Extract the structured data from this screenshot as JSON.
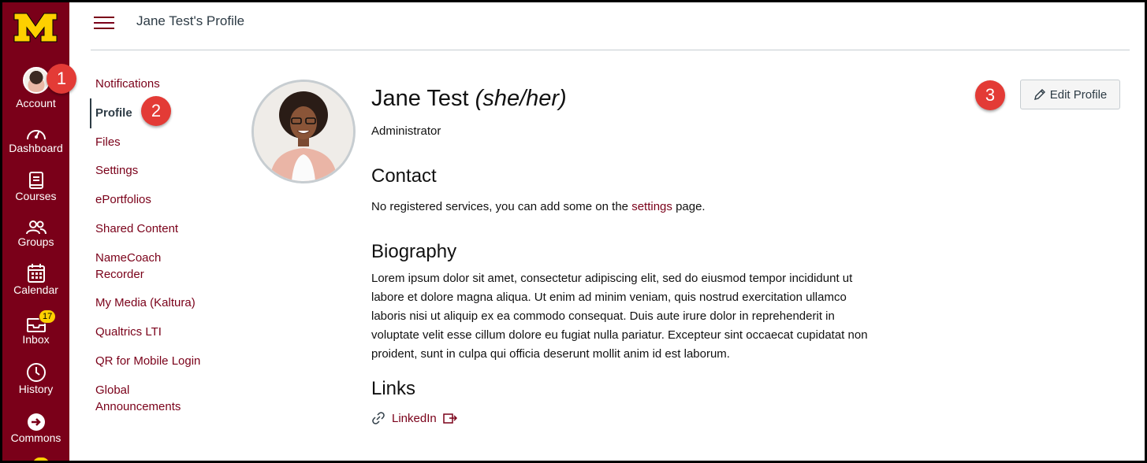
{
  "header": {
    "title": "Jane Test's Profile"
  },
  "global_nav": {
    "items": [
      {
        "label": "Account"
      },
      {
        "label": "Dashboard"
      },
      {
        "label": "Courses"
      },
      {
        "label": "Groups"
      },
      {
        "label": "Calendar"
      },
      {
        "label": "Inbox",
        "badge": "17"
      },
      {
        "label": "History"
      },
      {
        "label": "Commons"
      }
    ],
    "colors": {
      "background": "#7a0019",
      "badge": "#fdd000",
      "logo": "#fdd000"
    }
  },
  "section_nav": {
    "items": [
      {
        "label": "Notifications"
      },
      {
        "label": "Profile",
        "active": true
      },
      {
        "label": "Files"
      },
      {
        "label": "Settings"
      },
      {
        "label": "ePortfolios"
      },
      {
        "label": "Shared Content"
      },
      {
        "label": "NameCoach",
        "label2": "Recorder"
      },
      {
        "label": "My Media (Kaltura)"
      },
      {
        "label": "Qualtrics LTI"
      },
      {
        "label": "QR for Mobile Login"
      },
      {
        "label": "Global",
        "label2": "Announcements"
      }
    ]
  },
  "profile": {
    "name": "Jane Test",
    "pronouns": "(she/her)",
    "role": "Administrator",
    "edit_button": "Edit Profile",
    "contact": {
      "heading": "Contact",
      "text_before": "No registered services, you can add some on the",
      "link": "settings",
      "text_after": "page."
    },
    "biography": {
      "heading": "Biography",
      "lines": [
        "Lorem ipsum dolor sit amet, consectetur adipiscing elit, sed do eiusmod tempor incididunt ut",
        "labore et dolore magna aliqua. Ut enim ad minim veniam, quis nostrud exercitation ullamco",
        "laboris nisi ut aliquip ex ea commodo consequat. Duis aute irure dolor in reprehenderit in",
        "voluptate velit esse cillum dolore eu fugiat nulla pariatur. Excepteur sint occaecat cupidatat non",
        "proident, sunt in culpa qui officia deserunt mollit anim id est laborum."
      ]
    },
    "links": {
      "heading": "Links",
      "items": [
        {
          "label": "LinkedIn"
        }
      ]
    }
  },
  "callouts": [
    "1",
    "2",
    "3"
  ],
  "colors": {
    "accent": "#7a0019",
    "callout": "#e33b36",
    "text": "#2d3b45"
  }
}
